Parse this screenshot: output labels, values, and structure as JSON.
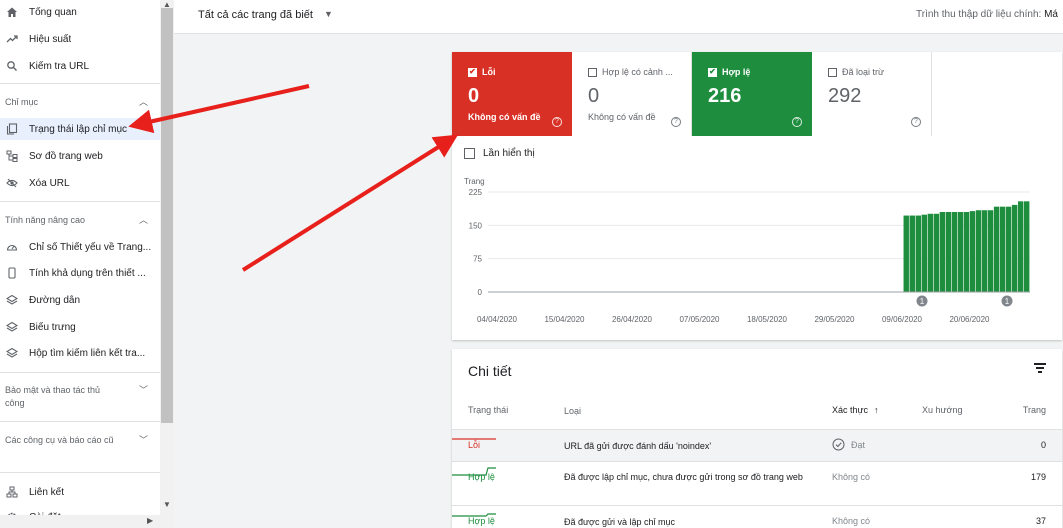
{
  "sidebar": {
    "top_items": [
      {
        "label": "Tổng quan",
        "icon": "home-icon"
      },
      {
        "label": "Hiệu suất",
        "icon": "trend-icon"
      },
      {
        "label": "Kiểm tra URL",
        "icon": "search-icon"
      }
    ],
    "sections": [
      {
        "title": "Chỉ mục",
        "items": [
          {
            "label": "Trạng thái lập chỉ mục",
            "icon": "pages-icon"
          },
          {
            "label": "Sơ đồ trang web",
            "icon": "sitemap-icon"
          },
          {
            "label": "Xóa URL",
            "icon": "eye-off-icon"
          }
        ]
      },
      {
        "title": "Tính năng nâng cao",
        "items": [
          {
            "label": "Chỉ số Thiết yếu về Trang...",
            "icon": "gauge-icon"
          },
          {
            "label": "Tính khả dụng trên thiết ...",
            "icon": "phone-icon"
          },
          {
            "label": "Đường dẫn",
            "icon": "layers-icon"
          },
          {
            "label": "Biểu trưng",
            "icon": "layers-icon"
          },
          {
            "label": "Hộp tìm kiếm liên kết tra...",
            "icon": "layers-icon"
          }
        ]
      },
      {
        "title": "Bảo mật và thao tác thủ công",
        "items": []
      },
      {
        "title": "Các công cụ và báo cáo cũ",
        "items": []
      }
    ],
    "bottom_items": [
      {
        "label": "Liên kết",
        "icon": "links-icon"
      },
      {
        "label": "Cài đặt",
        "icon": "settings-icon"
      }
    ]
  },
  "topbar": {
    "filter_label": "Tất cả các trang đã biết",
    "crawler_label": "Trình thu thập dữ liệu chính:",
    "crawler_value": "Má"
  },
  "tiles": [
    {
      "label": "Lỗi",
      "value": "0",
      "sub": "Không có vấn đề",
      "checked": true,
      "color": "#d93025"
    },
    {
      "label": "Hợp lệ có cảnh ...",
      "value": "0",
      "sub": "Không có vấn đề",
      "checked": false,
      "color": "#5f6368"
    },
    {
      "label": "Hợp lệ",
      "value": "216",
      "sub": "",
      "checked": true,
      "color": "#1e8e3e"
    },
    {
      "label": "Đã loại trừ",
      "value": "292",
      "sub": "",
      "checked": false,
      "color": "#5f6368"
    }
  ],
  "impressions_label": "Lần hiển thị",
  "chart_data": {
    "type": "bar",
    "ylabel": "Trang",
    "ylim": [
      0,
      225
    ],
    "yticks": [
      0,
      75,
      150,
      225
    ],
    "xticks": [
      "04/04/2020",
      "15/04/2020",
      "26/04/2020",
      "07/05/2020",
      "18/05/2020",
      "29/05/2020",
      "09/06/2020",
      "20/06/2020"
    ],
    "series": [
      {
        "color": "#1e8e3e",
        "values": [
          0,
          0,
          0,
          0,
          0,
          0,
          0,
          0,
          0,
          0,
          0,
          0,
          0,
          0,
          0,
          0,
          0,
          0,
          0,
          0,
          0,
          0,
          0,
          0,
          0,
          0,
          0,
          0,
          0,
          0,
          0,
          0,
          0,
          0,
          0,
          0,
          0,
          0,
          0,
          0,
          0,
          0,
          0,
          0,
          0,
          0,
          0,
          0,
          0,
          0,
          0,
          0,
          0,
          0,
          0,
          0,
          0,
          0,
          0,
          0,
          0,
          0,
          0,
          0,
          0,
          0,
          0,
          0,
          0,
          172,
          172,
          172,
          174,
          176,
          176,
          180,
          180,
          180,
          180,
          180,
          182,
          184,
          184,
          184,
          192,
          192,
          192,
          196,
          204,
          204
        ]
      },
      {
        "color": "#d93025",
        "values": [
          0,
          0,
          0,
          0,
          0,
          0,
          0,
          0,
          0,
          0,
          0,
          0,
          0,
          0,
          0,
          0,
          0,
          0,
          0,
          0,
          0,
          0,
          0,
          0,
          0,
          0,
          0,
          0,
          0,
          0,
          0,
          0,
          0,
          0,
          0,
          0,
          0,
          0,
          0,
          0,
          0,
          0,
          0,
          0,
          0,
          0,
          0,
          0,
          0,
          0,
          0,
          0,
          0,
          0,
          0,
          0,
          0,
          0,
          0,
          0,
          0,
          0,
          0,
          0,
          0,
          0,
          0,
          0,
          0,
          0,
          0,
          0,
          0,
          0,
          0,
          0,
          0,
          0,
          0,
          0,
          0,
          0,
          0,
          0,
          0,
          0,
          0,
          0,
          0,
          0
        ]
      }
    ],
    "annotations": [
      "1",
      "1"
    ],
    "grid": true
  },
  "details": {
    "title": "Chi tiết",
    "columns": [
      "Trạng thái",
      "Loại",
      "Xác thực",
      "Xu hướng",
      "Trang"
    ],
    "rows": [
      {
        "status": "Lỗi",
        "type": "URL đã gửi được đánh dấu 'noindex'",
        "verification": "Đạt",
        "pages": "0",
        "trend_color": "#d93025"
      },
      {
        "status": "Hợp lệ",
        "type": "Đã được lập chỉ mục, chưa được gửi trong sơ đồ trang web",
        "verification": "Không có",
        "pages": "179",
        "trend_color": "#1e8e3e"
      },
      {
        "status": "Hợp lệ",
        "type": "Đã được gửi và lập chỉ mục",
        "verification": "Không có",
        "pages": "37",
        "trend_color": "#1e8e3e"
      }
    ]
  }
}
